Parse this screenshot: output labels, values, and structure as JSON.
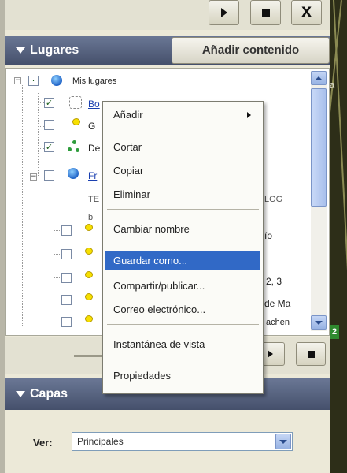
{
  "toolbar": {
    "play_icon": "play-icon",
    "stop_icon": "stop-icon",
    "close_icon": "close-icon",
    "close_label": "X"
  },
  "lugares": {
    "title": "Lugares",
    "add_content_label": "Añadir contenido"
  },
  "tree": {
    "root_label": "Mis lugares",
    "rows": [
      {
        "label": "Bo",
        "checked": true
      },
      {
        "label": "G",
        "checked": false
      },
      {
        "label": "De",
        "checked": true
      },
      {
        "label": "Fr",
        "checked": false
      }
    ],
    "cut_texts": [
      "TE",
      "LOG",
      "b",
      "ío",
      "2, 3",
      "de Ma",
      "achen"
    ]
  },
  "context_menu": {
    "items": [
      "Añadir",
      "Cortar",
      "Copiar",
      "Eliminar",
      "Cambiar nombre",
      "Guardar como...",
      "Compartir/publicar...",
      "Correo electrónico...",
      "Instantánea de vista",
      "Propiedades"
    ],
    "selected": "Guardar como..."
  },
  "capas": {
    "title": "Capas",
    "ver_label": "Ver:",
    "ver_value": "Principales"
  },
  "map": {
    "tab_label": "2",
    "cut_label": "a"
  }
}
